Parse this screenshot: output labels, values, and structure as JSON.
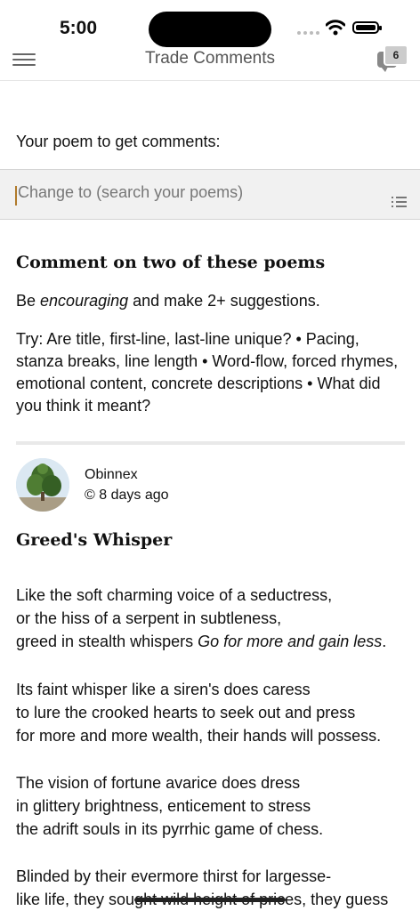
{
  "status_bar": {
    "time": "5:00"
  },
  "navbar": {
    "title": "Trade Comments",
    "comments_badge": "6"
  },
  "poem_selector": {
    "label": "Your poem to get comments:",
    "placeholder": "Change to (search your poems)"
  },
  "instructions": {
    "heading": "Comment on two of these poems",
    "be": "Be ",
    "encouraging": "encouraging",
    "suggestions": " and make 2+ suggestions.",
    "tips": "Try: Are title, first-line, last-line unique? • Pacing, stanza breaks, line length • Word-flow, forced rhymes, emotional content, concrete descriptions • What did you think it meant?"
  },
  "post": {
    "author": "Obinnex",
    "time": "© 8 days ago",
    "title": "Greed's Whisper",
    "stanza1": {
      "line1": "Like the soft charming voice of a seductress,",
      "line2": "or the hiss of a serpent in subtleness,",
      "line3_start": "greed in stealth whispers ",
      "line3_italic": "Go for more and gain less",
      "line3_end": "."
    },
    "stanza2": [
      "Its faint whisper like a siren's does caress",
      "to lure the crooked hearts to seek out and press",
      "for more and more wealth, their hands will possess."
    ],
    "stanza3": [
      "The vision of fortune avarice does dress",
      "in glittery brightness, enticement to stress",
      "the adrift souls in its pyrrhic game of chess."
    ],
    "stanza4": [
      "Blinded by their evermore thirst for largesse-",
      "like life, they sought wild height of prices, they guess"
    ]
  }
}
